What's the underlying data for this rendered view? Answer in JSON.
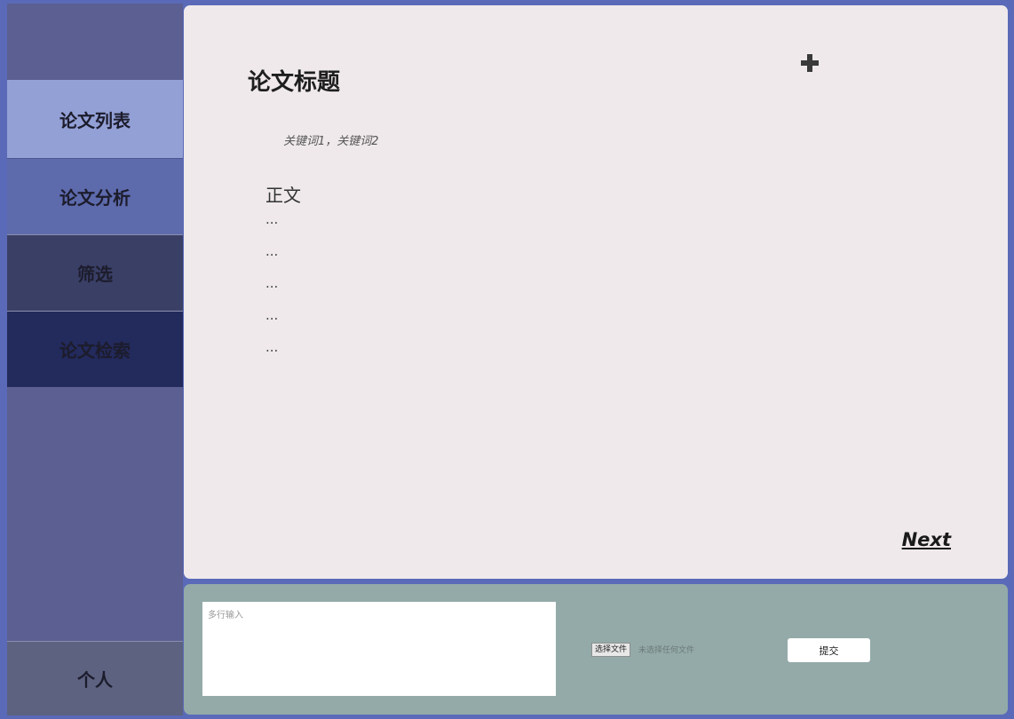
{
  "sidebar": {
    "items": [
      {
        "label": "论文列表"
      },
      {
        "label": "论文分析"
      },
      {
        "label": "筛选"
      },
      {
        "label": "论文检索"
      }
    ],
    "personal": "个人"
  },
  "main": {
    "title": "论文标题",
    "keywords": "关键词1，关键词2",
    "body_heading": "正文",
    "body_lines": [
      "...",
      "...",
      "...",
      "...",
      "..."
    ],
    "next": "Next",
    "add_icon": "plus-icon"
  },
  "bottom": {
    "textarea_placeholder": "多行输入",
    "file_button": "选择文件",
    "file_status": "未选择任何文件",
    "submit": "提交"
  },
  "colors": {
    "sidebar_bg": "#5b5f92",
    "active_item": "#93a0d6",
    "main_bg": "#efe9eb",
    "bottom_bg": "#93aaa8",
    "frame_border": "#5a6ab8"
  }
}
